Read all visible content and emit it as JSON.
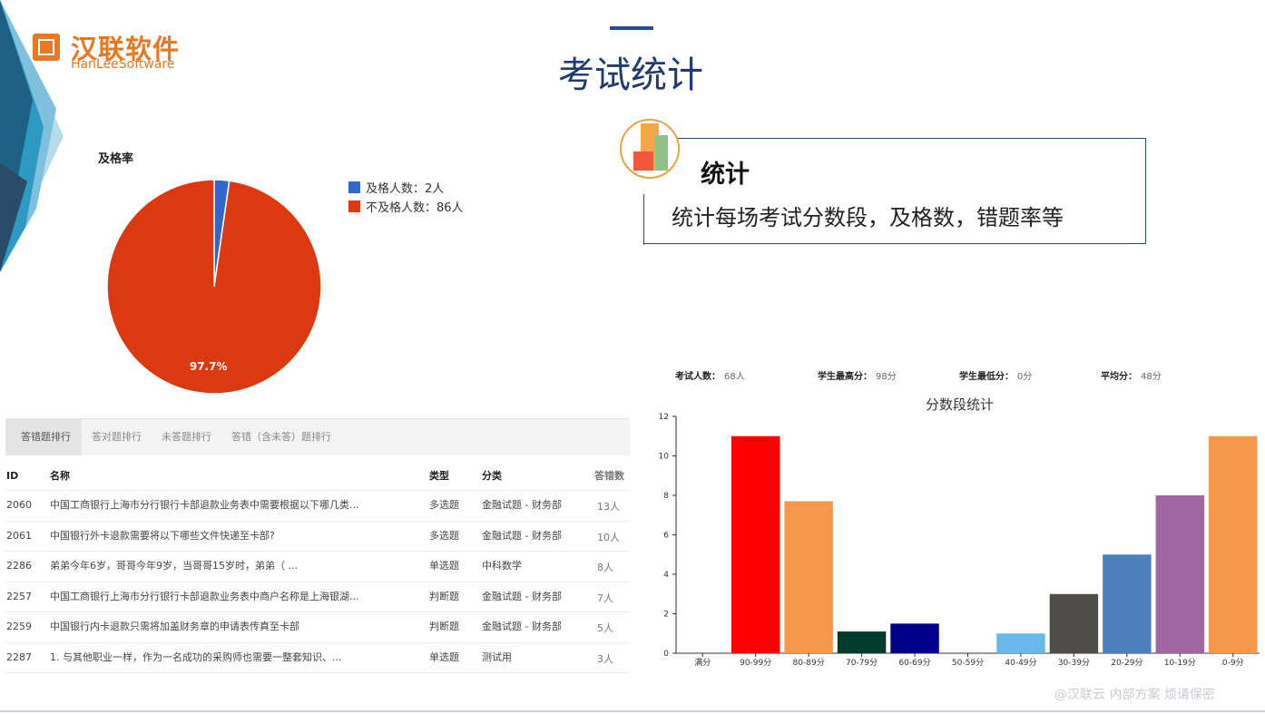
{
  "logo": {
    "cn": "汉联软件",
    "en": "HanLeeSoftware"
  },
  "page_title": "考试统计",
  "pass_rate": {
    "title": "及格率",
    "legend": [
      {
        "label": "及格人数：2人",
        "color": "#3366cc"
      },
      {
        "label": "不及格人数：86人",
        "color": "#dc3912"
      }
    ],
    "slice_label": "97.7%"
  },
  "feature": {
    "title": "统计",
    "desc": "统计每场考试分数段，及格数，错题率等"
  },
  "tabs": [
    "答错题排行",
    "答对题排行",
    "未答题排行",
    "答错（含未答）题排行"
  ],
  "table": {
    "headers": {
      "id": "ID",
      "name": "名称",
      "type": "类型",
      "category": "分类",
      "count": "答错数"
    },
    "rows": [
      {
        "id": "2060",
        "name": "中国工商银行上海市分行银行卡部退款业务表中需要根据以下哪几类...",
        "type": "多选题",
        "category": "金融试题 - 财务部",
        "count": "13人"
      },
      {
        "id": "2061",
        "name": "中国银行外卡退款需要将以下哪些文件快递至卡部?",
        "type": "多选题",
        "category": "金融试题 - 财务部",
        "count": "10人"
      },
      {
        "id": "2286",
        "name": "弟弟今年6岁，哥哥今年9岁，当哥哥15岁时，弟弟（ ...",
        "type": "单选题",
        "category": "中科数学",
        "count": "8人"
      },
      {
        "id": "2257",
        "name": "中国工商银行上海市分行银行卡部退款业务表中商户名称是上海银湖...",
        "type": "判断题",
        "category": "金融试题 - 财务部",
        "count": "7人"
      },
      {
        "id": "2259",
        "name": "中国银行内卡退款只需将加盖财务章的申请表传真至卡部",
        "type": "判断题",
        "category": "金融试题 - 财务部",
        "count": "5人"
      },
      {
        "id": "2287",
        "name": "1. 与其他职业一样，作为一名成功的采购师也需要一整套知识、...",
        "type": "单选题",
        "category": "测试用",
        "count": "3人"
      }
    ]
  },
  "stats": [
    {
      "label": "考试人数：",
      "value": "68人"
    },
    {
      "label": "学生最高分：",
      "value": "98分"
    },
    {
      "label": "学生最低分：",
      "value": "0分"
    },
    {
      "label": "平均分：",
      "value": "48分"
    }
  ],
  "watermark": "@汉联云 内部方案 烦请保密",
  "chart_data": [
    {
      "type": "pie",
      "title": "及格率",
      "categories": [
        "及格人数：2人",
        "不及格人数：86人"
      ],
      "values": [
        2,
        86
      ],
      "colors": [
        "#3366cc",
        "#dc3912"
      ],
      "data_labels": [
        "",
        "97.7%"
      ],
      "legend_position": "right"
    },
    {
      "type": "bar",
      "title": "分数段统计",
      "categories": [
        "满分",
        "90-99分",
        "80-89分",
        "70-79分",
        "60-69分",
        "50-59分",
        "40-49分",
        "30-39分",
        "20-29分",
        "10-19分",
        "0-9分"
      ],
      "values": [
        0,
        11,
        7.7,
        1.1,
        1.5,
        0,
        1,
        3,
        5,
        8,
        11
      ],
      "colors": [
        "#1f77b4",
        "#ff0000",
        "#f59849",
        "#003c2a",
        "#00008b",
        "#888888",
        "#6ab8ea",
        "#4f4d4a",
        "#4d80bc",
        "#a066a1",
        "#f59849"
      ],
      "yticks": [
        0,
        2,
        4,
        6,
        8,
        10,
        12
      ],
      "ylim": [
        0,
        12
      ],
      "grid": false
    }
  ]
}
